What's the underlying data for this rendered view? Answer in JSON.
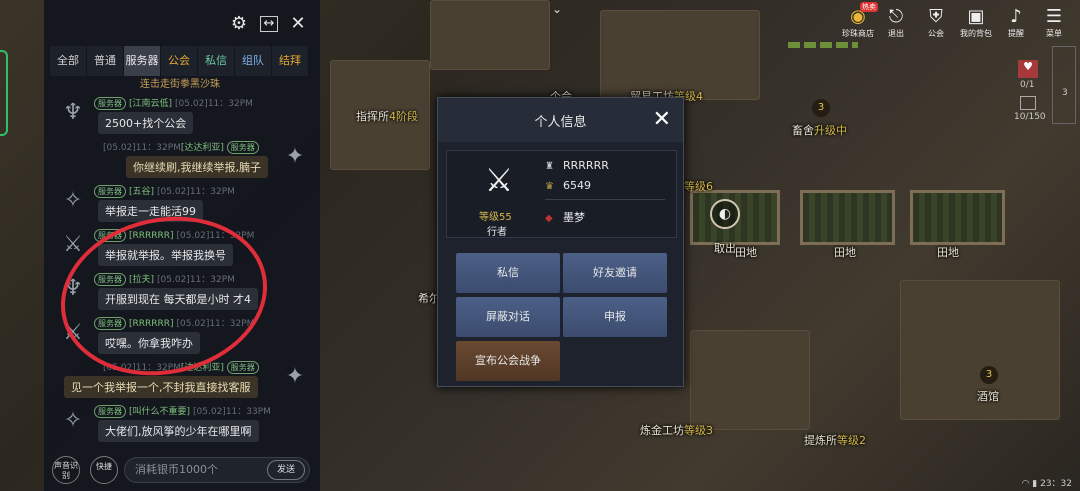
{
  "chat": {
    "tabs": [
      {
        "label": "全部"
      },
      {
        "label": "普通"
      },
      {
        "label": "服务器"
      },
      {
        "label": "公会"
      },
      {
        "label": "私信"
      },
      {
        "label": "组队"
      },
      {
        "label": "结拜"
      }
    ],
    "top_partial": "连击走街拳黑沙珠",
    "messages": [
      {
        "tag": "服务器",
        "name": "[江南云低]",
        "time": "[05.02]11：32PM",
        "text": "2500+找个公会",
        "side": "left"
      },
      {
        "tag": "服务器",
        "name": "[达达利亚]",
        "time": "[05.02]11：32PM",
        "text": "你继续刷,我继续举报,腩子",
        "side": "right"
      },
      {
        "tag": "服务器",
        "name": "[五谷]",
        "time": "[05.02]11：32PM",
        "text": "举报走一走能活99",
        "side": "left"
      },
      {
        "tag": "服务器",
        "name": "[RRRRRR]",
        "time": "[05.02]11：32PM",
        "text": "举报就举报。举报我换号",
        "side": "left"
      },
      {
        "tag": "服务器",
        "name": "[拉夫]",
        "time": "[05.02]11：32PM",
        "text": "开服到现在 每天都是小时  才4",
        "side": "left"
      },
      {
        "tag": "服务器",
        "name": "[RRRRRR]",
        "time": "[05.02]11：32PM",
        "text": "哎嘿。你拿我咋办",
        "side": "left"
      },
      {
        "tag": "服务器",
        "name": "[达达利亚]",
        "time": "[05.02]11：32PM",
        "text": "见一个我举报一个,不封我直接找客服",
        "side": "right"
      },
      {
        "tag": "服务器",
        "name": "[叫什么不重要]",
        "time": "[05.02]11：33PM",
        "text": "大佬们,放风筝的少年在哪里啊",
        "side": "left"
      }
    ],
    "voice_label": "声音识别",
    "quick_label": "快捷",
    "input_placeholder": "消耗银币1000个",
    "send_label": "发送"
  },
  "hud": {
    "items": [
      {
        "label": "珍珠商店",
        "badge": "热卖"
      },
      {
        "label": "退出"
      },
      {
        "label": "公会"
      },
      {
        "label": "我的背包"
      },
      {
        "label": "提醒"
      },
      {
        "label": "菜单"
      }
    ],
    "side": {
      "a": "0/1",
      "b": "10/150",
      "c": "3"
    }
  },
  "map_labels": {
    "zhihui": "指挥所",
    "zhihui_lv": "4阶段",
    "maoyi": "贸易工坊",
    "maoyi_lv": "等级4",
    "xumu": "畜舍",
    "xumu_lv": "升级中",
    "lv6": "等级6",
    "quchu": "取出",
    "tiandi1": "田地",
    "tiandi2": "田地",
    "tiandi3": "田地",
    "xier": "希尔",
    "jiuguan": "酒馆",
    "lianjin": "炼金工坊",
    "lianjin_lv": "等级3",
    "tilian": "提炼所",
    "tilian_lv": "等级2",
    "num3": "3",
    "gehui": "个会"
  },
  "modal": {
    "title": "个人信息",
    "level": "等级55",
    "job": "行者",
    "name": "RRRRRR",
    "power": "6549",
    "guild": "墨梦",
    "buttons": {
      "whisper": "私信",
      "friend": "好友邀请",
      "block": "屏蔽对话",
      "report": "申报",
      "war": "宣布公会战争"
    }
  },
  "status": {
    "time": "23：32"
  }
}
